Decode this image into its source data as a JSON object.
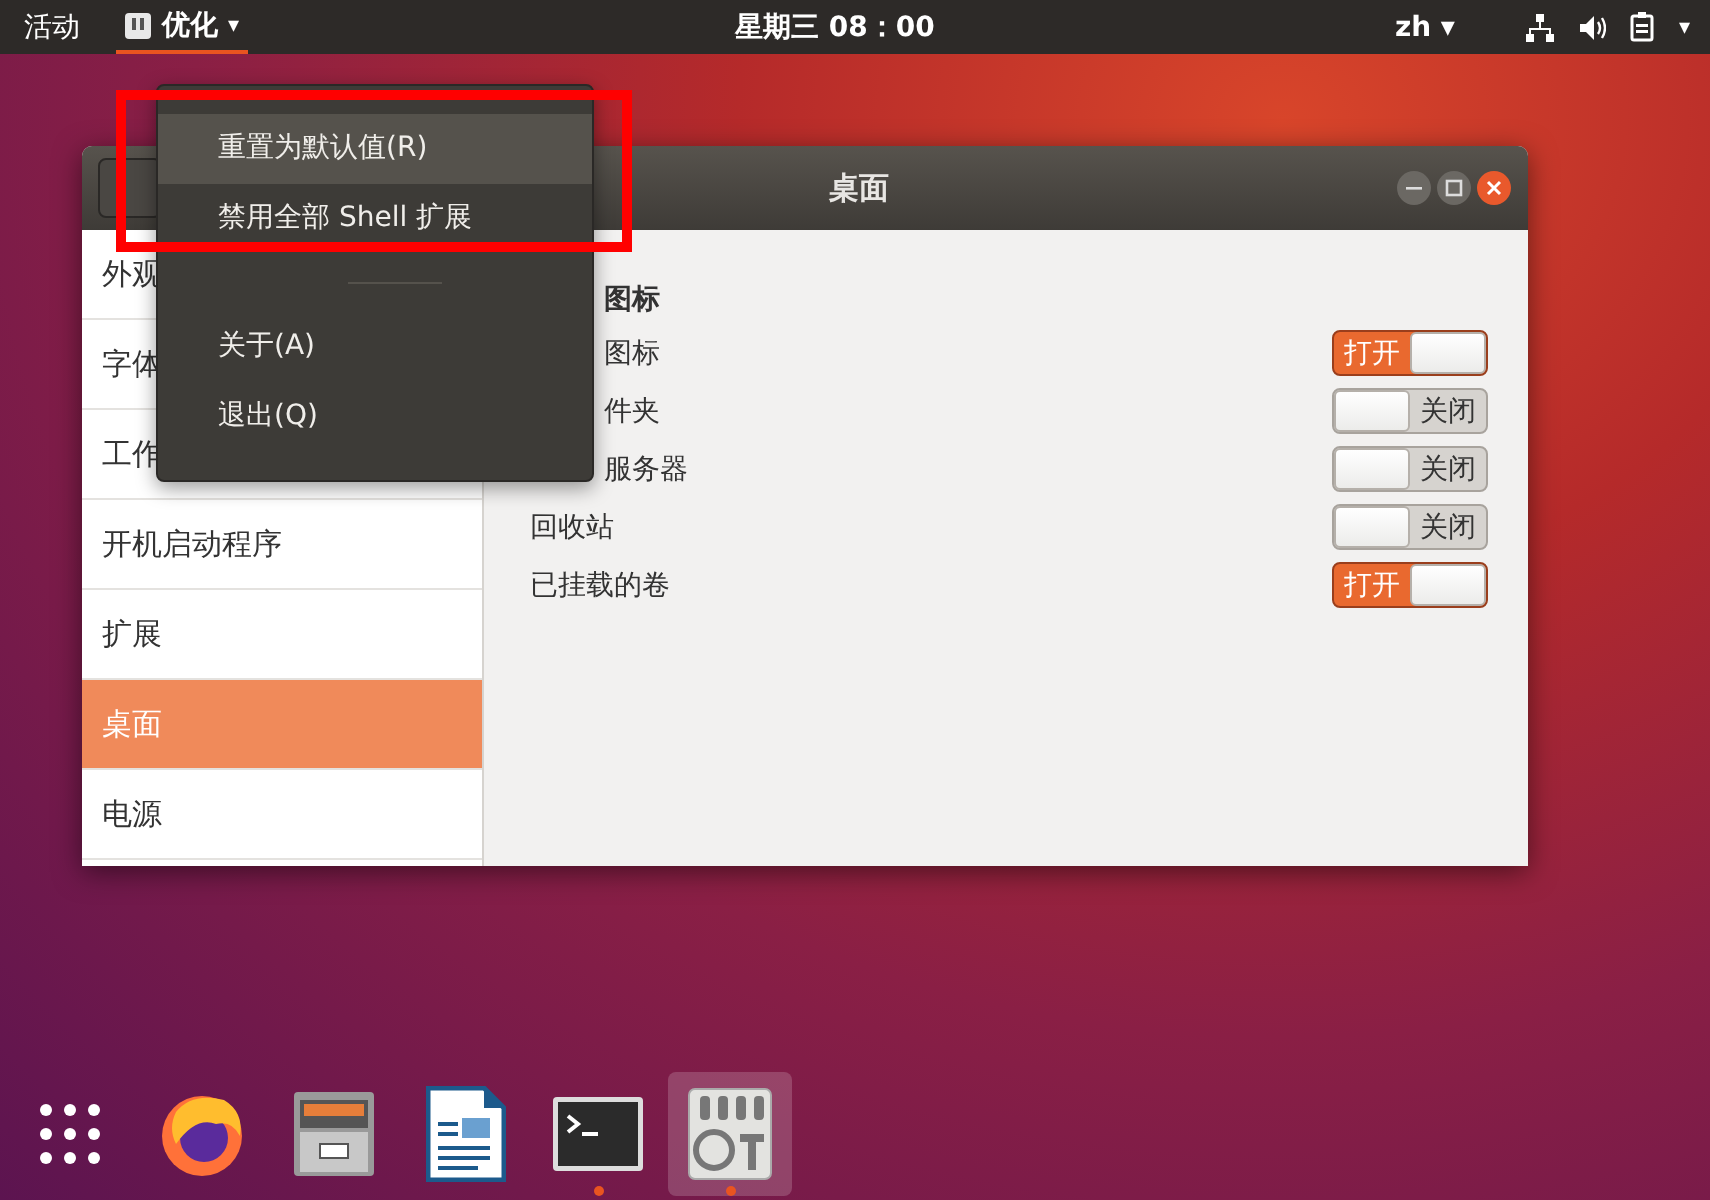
{
  "top_bar": {
    "activities": "活动",
    "app_menu": {
      "label": "优化",
      "caret": "▾"
    },
    "clock": "星期三 08：00",
    "input_method": {
      "label": "zh",
      "caret": "▾"
    },
    "system_caret": "▾"
  },
  "app_menu_popup": {
    "items": [
      {
        "label": "重置为默认值(R)",
        "highlighted": true,
        "kind": "item"
      },
      {
        "label": "禁用全部 Shell 扩展",
        "highlighted": false,
        "kind": "item"
      },
      {
        "kind": "separator"
      },
      {
        "label": "关于(A)",
        "highlighted": false,
        "kind": "item"
      },
      {
        "label": "退出(Q)",
        "highlighted": false,
        "kind": "item"
      }
    ]
  },
  "window": {
    "title": "桌面",
    "sidebar": {
      "items": [
        {
          "label": "外观",
          "selected": false
        },
        {
          "label": "字体",
          "selected": false
        },
        {
          "label": "工作",
          "selected": false
        },
        {
          "label": "开机启动程序",
          "selected": false
        },
        {
          "label": "扩展",
          "selected": false
        },
        {
          "label": "桌面",
          "selected": true
        },
        {
          "label": "电源",
          "selected": false
        }
      ]
    },
    "section_heading": {
      "label": "图标",
      "partly_hidden": true
    },
    "settings": [
      {
        "label": "图标",
        "partly_hidden": true,
        "on": true,
        "state_text": "打开"
      },
      {
        "label": "件夹",
        "partly_hidden": true,
        "on": false,
        "state_text": "关闭"
      },
      {
        "label": "服务器",
        "partly_hidden": true,
        "on": false,
        "state_text": "关闭"
      },
      {
        "label": "回收站",
        "partly_hidden": false,
        "on": false,
        "state_text": "关闭"
      },
      {
        "label": "已挂载的卷",
        "partly_hidden": false,
        "on": true,
        "state_text": "打开"
      }
    ]
  },
  "dock": {
    "items": [
      {
        "kind": "apps",
        "running": false,
        "selected": false
      },
      {
        "kind": "browser",
        "running": false,
        "selected": false
      },
      {
        "kind": "files",
        "running": false,
        "selected": false
      },
      {
        "kind": "writer",
        "running": false,
        "selected": false
      },
      {
        "kind": "terminal",
        "running": true,
        "selected": false
      },
      {
        "kind": "tweaks",
        "running": true,
        "selected": true
      }
    ]
  }
}
